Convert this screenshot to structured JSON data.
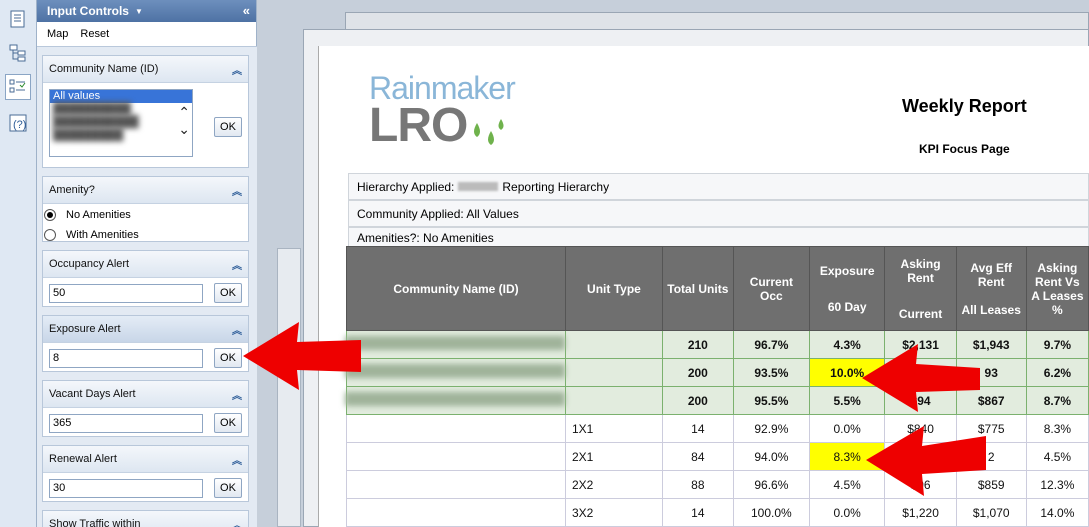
{
  "panel": {
    "title": "Input Controls",
    "menu": [
      "Map",
      "Reset"
    ],
    "controls": {
      "community": {
        "label": "Community Name (ID)",
        "selected": "All values",
        "ok": "OK"
      },
      "amenity": {
        "label": "Amenity?",
        "options": [
          "No Amenities",
          "With Amenities"
        ]
      },
      "occupancy": {
        "label": "Occupancy Alert",
        "value": "50",
        "ok": "OK"
      },
      "exposure": {
        "label": "Exposure Alert",
        "value": "8",
        "ok": "OK"
      },
      "vacant": {
        "label": "Vacant Days Alert",
        "value": "365",
        "ok": "OK"
      },
      "renewal": {
        "label": "Renewal Alert",
        "value": "30",
        "ok": "OK"
      },
      "traffic": {
        "label": "Show Traffic within"
      }
    }
  },
  "report": {
    "logo_top": "Rainmaker",
    "logo_bottom": "LRO",
    "title": "Weekly Report",
    "subtitle": "KPI Focus Page",
    "hierarchy_prefix": "Hierarchy Applied:",
    "hierarchy_suffix": "Reporting Hierarchy",
    "community_applied": "Community Applied: All Values",
    "amenities_applied": "Amenities?: No Amenities",
    "headers": {
      "community": "Community Name (ID)",
      "unit_type": "Unit Type",
      "total_units": "Total Units",
      "current_occ": "Current Occ",
      "exposure_a": "Exposure",
      "exposure_b": "60 Day",
      "asking_a": "Asking Rent",
      "asking_b": "Current",
      "avg_a": "Avg Eff Rent",
      "avg_b": "All Leases",
      "asking_vs": "Asking Rent Vs A Leases %"
    },
    "rows": [
      {
        "group": true,
        "unit": "",
        "total": "210",
        "occ": "96.7%",
        "exp": "4.3%",
        "ask": "$2,131",
        "avg": "$1,943",
        "vs": "9.7%"
      },
      {
        "group": true,
        "unit": "",
        "total": "200",
        "occ": "93.5%",
        "exp": "10.0%",
        "ask": "",
        "avg": "93",
        "vs": "6.2%",
        "hl": true
      },
      {
        "group": true,
        "unit": "",
        "total": "200",
        "occ": "95.5%",
        "exp": "5.5%",
        "ask": "$94",
        "avg": "$867",
        "vs": "8.7%"
      },
      {
        "group": false,
        "unit": "1X1",
        "total": "14",
        "occ": "92.9%",
        "exp": "0.0%",
        "ask": "$840",
        "avg": "$775",
        "vs": "8.3%"
      },
      {
        "group": false,
        "unit": "2X1",
        "total": "84",
        "occ": "94.0%",
        "exp": "8.3%",
        "ask": "",
        "avg": "2",
        "vs": "4.5%",
        "hl": true
      },
      {
        "group": false,
        "unit": "2X2",
        "total": "88",
        "occ": "96.6%",
        "exp": "4.5%",
        "ask": "$96",
        "avg": "$859",
        "vs": "12.3%"
      },
      {
        "group": false,
        "unit": "3X2",
        "total": "14",
        "occ": "100.0%",
        "exp": "0.0%",
        "ask": "$1,220",
        "avg": "$1,070",
        "vs": "14.0%"
      }
    ]
  }
}
